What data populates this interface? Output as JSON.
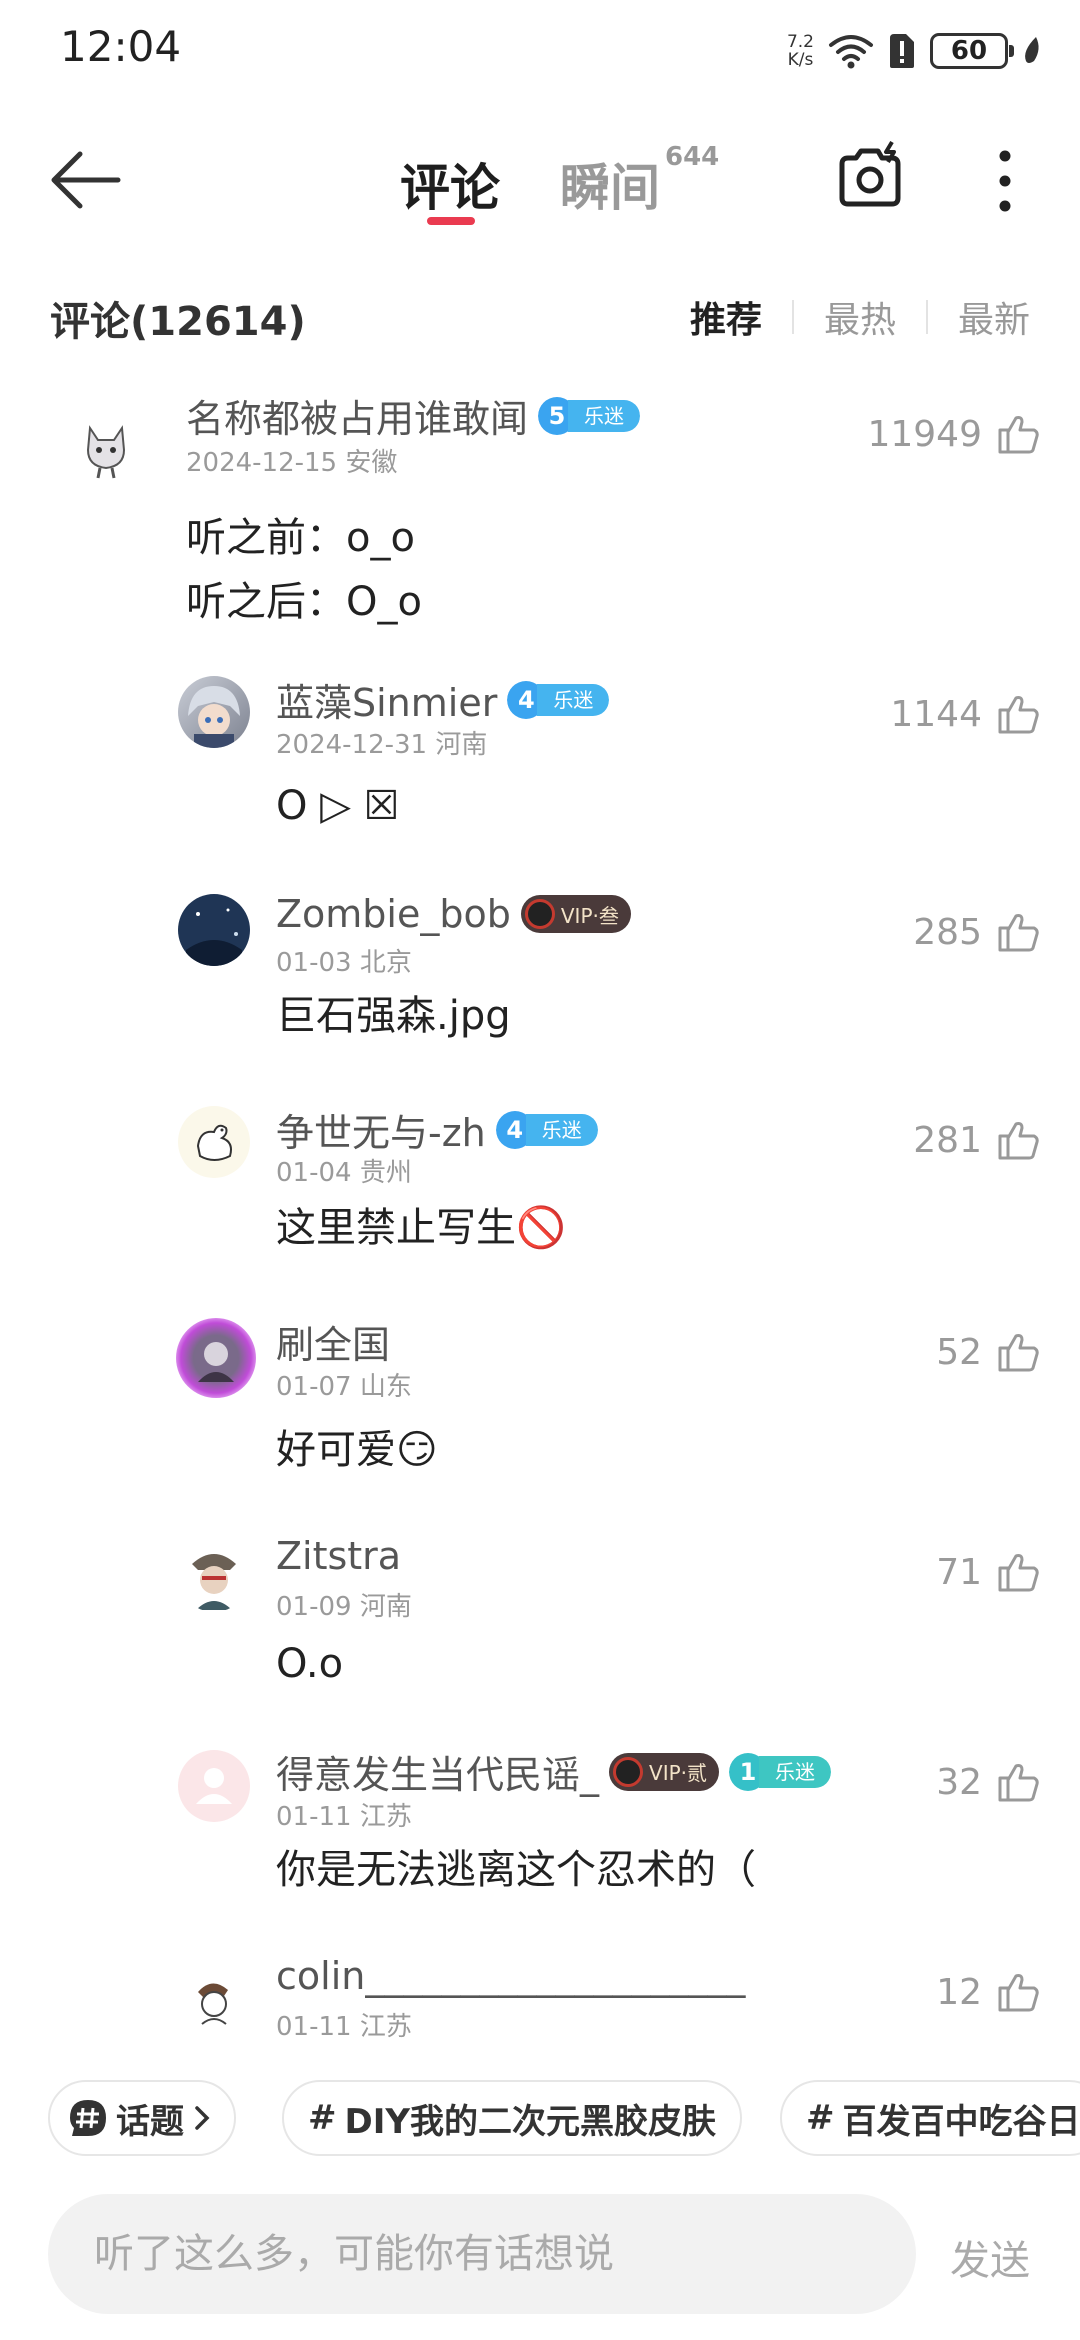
{
  "status_bar": {
    "time": "12:04",
    "net_speed_value": "7.2",
    "net_speed_unit": "K/s",
    "battery": "60"
  },
  "header": {
    "tab_comments": "评论",
    "tab_moments": "瞬间",
    "tab_moments_count": "644",
    "accent_color": "#ea3b50"
  },
  "sort": {
    "comment_count": "评论(12614)",
    "tabs": [
      "推荐",
      "最热",
      "最新"
    ],
    "active": "推荐"
  },
  "comments": [
    {
      "user": "名称都被占用谁敢闻",
      "badge_level": "5",
      "badge_text": "乐迷",
      "meta": "2024-12-15 安徽",
      "likes": "11949",
      "text": "听之前：o_o\n听之后：O_o"
    },
    {
      "user": "蓝藻Sinmier",
      "badge_level": "4",
      "badge_text": "乐迷",
      "meta": "2024-12-31 河南",
      "likes": "1144",
      "text": "O ▷ ☒"
    },
    {
      "user": "Zombie_bob",
      "vip": "VIP·叁",
      "meta": "01-03 北京",
      "likes": "285",
      "text": "巨石强森.jpg"
    },
    {
      "user": "争世无与-zh",
      "badge_level": "4",
      "badge_text": "乐迷",
      "meta": "01-04 贵州",
      "likes": "281",
      "text": "这里禁止写生🚫"
    },
    {
      "user": "刷全国",
      "meta": "01-07 山东",
      "likes": "52",
      "text": "好可爱😏"
    },
    {
      "user": "Zitstra",
      "meta": "01-09 河南",
      "likes": "71",
      "text": "O.o"
    },
    {
      "user": "得意发生当代民谣_",
      "vip": "VIP·贰",
      "badge_level": "1",
      "badge_text": "乐迷",
      "meta": "01-11 江苏",
      "likes": "32",
      "text": "你是无法逃离这个忍术的（"
    },
    {
      "user": "colin____________________",
      "meta": "01-11 江苏",
      "likes": "12"
    }
  ],
  "topics": {
    "label": "话题",
    "chips": [
      "DIY我的二次元黑胶皮肤",
      "百发百中吃谷日"
    ]
  },
  "input": {
    "placeholder": "听了这么多，可能你有话想说",
    "send": "发送"
  }
}
